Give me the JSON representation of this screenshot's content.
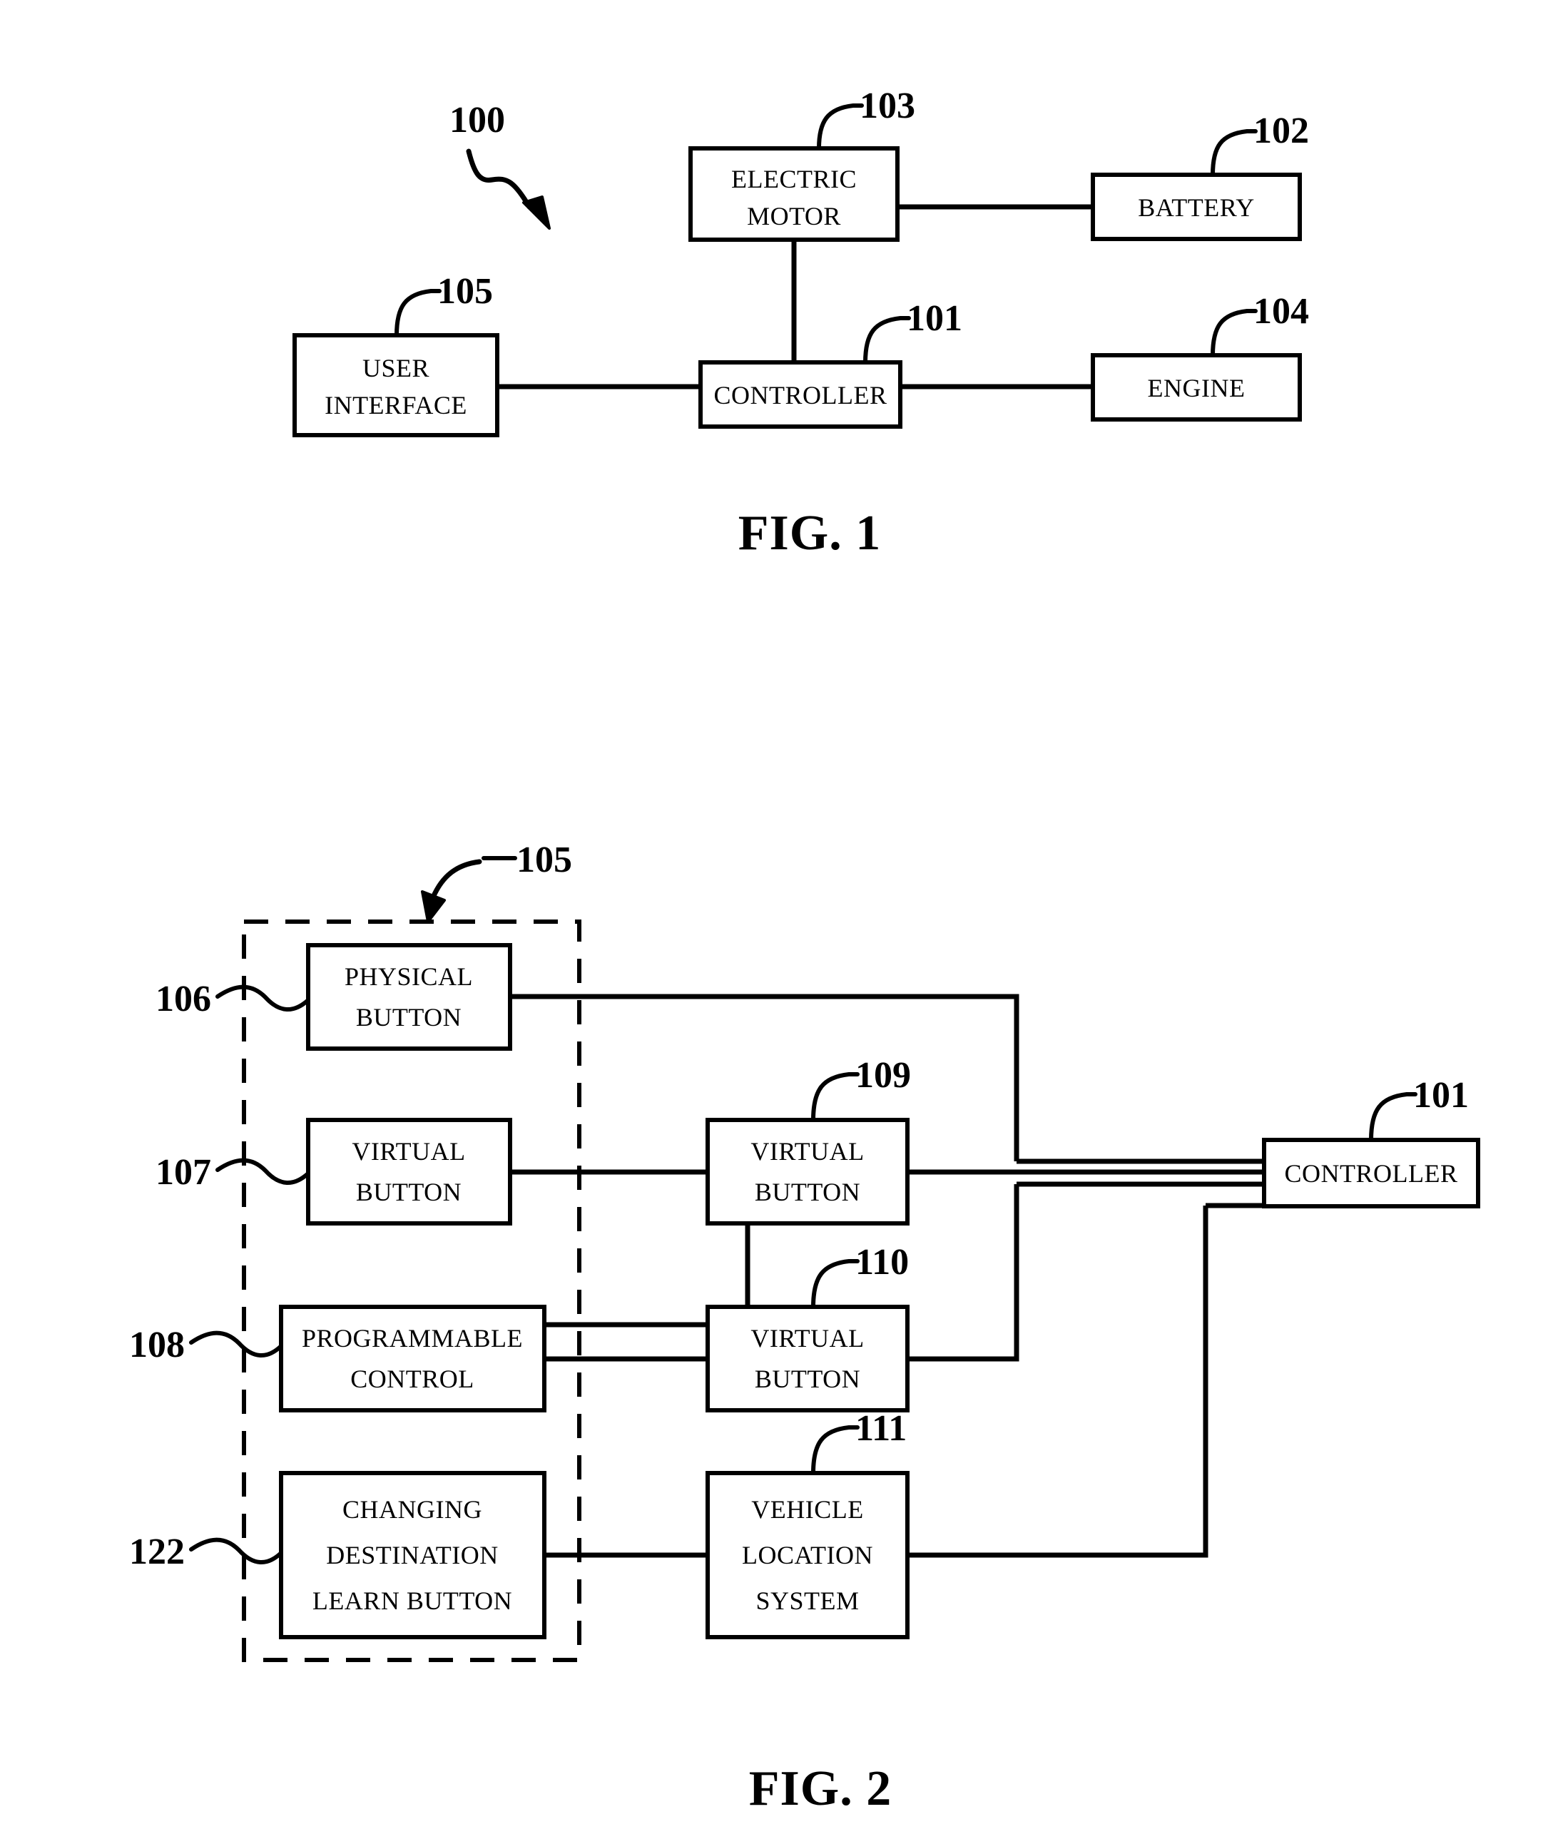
{
  "document": {
    "type": "patent-drawing-sheet",
    "figures": [
      {
        "id": "fig1",
        "caption": "FIG. 1",
        "system_reference": "100",
        "blocks": [
          {
            "ref": "103",
            "label_line1": "ELECTRIC",
            "label_line2": "MOTOR"
          },
          {
            "ref": "102",
            "label_line1": "BATTERY",
            "label_line2": ""
          },
          {
            "ref": "105",
            "label_line1": "USER",
            "label_line2": "INTERFACE"
          },
          {
            "ref": "101",
            "label_line1": "CONTROLLER",
            "label_line2": ""
          },
          {
            "ref": "104",
            "label_line1": "ENGINE",
            "label_line2": ""
          }
        ],
        "connections": [
          {
            "from": "103",
            "to": "102"
          },
          {
            "from": "103",
            "to": "101"
          },
          {
            "from": "105",
            "to": "101"
          },
          {
            "from": "101",
            "to": "104"
          }
        ]
      },
      {
        "id": "fig2",
        "caption": "FIG. 2",
        "enclosure_reference": "105",
        "blocks": [
          {
            "ref": "106",
            "label_line1": "PHYSICAL",
            "label_line2": "BUTTON",
            "label_line3": ""
          },
          {
            "ref": "107",
            "label_line1": "VIRTUAL",
            "label_line2": "BUTTON",
            "label_line3": ""
          },
          {
            "ref": "108",
            "label_line1": "PROGRAMMABLE",
            "label_line2": "CONTROL",
            "label_line3": ""
          },
          {
            "ref": "122",
            "label_line1": "CHANGING",
            "label_line2": "DESTINATION",
            "label_line3": "LEARN BUTTON"
          },
          {
            "ref": "109",
            "label_line1": "VIRTUAL",
            "label_line2": "BUTTON",
            "label_line3": ""
          },
          {
            "ref": "110",
            "label_line1": "VIRTUAL",
            "label_line2": "BUTTON",
            "label_line3": ""
          },
          {
            "ref": "111",
            "label_line1": "VEHICLE",
            "label_line2": "LOCATION",
            "label_line3": "SYSTEM"
          },
          {
            "ref": "101",
            "label_line1": "CONTROLLER",
            "label_line2": "",
            "label_line3": ""
          }
        ],
        "connections": [
          {
            "from": "106",
            "to": "101"
          },
          {
            "from": "107",
            "to": "109"
          },
          {
            "from": "108",
            "to": "109"
          },
          {
            "from": "108",
            "to": "110"
          },
          {
            "from": "109",
            "to": "101"
          },
          {
            "from": "110",
            "to": "101"
          },
          {
            "from": "122",
            "to": "111"
          },
          {
            "from": "111",
            "to": "101"
          }
        ]
      }
    ]
  },
  "fig1": {
    "caption": "FIG. 1",
    "ref_system": "100",
    "electric_motor": {
      "line1": "ELECTRIC",
      "line2": "MOTOR",
      "ref": "103"
    },
    "battery": {
      "line1": "BATTERY",
      "ref": "102"
    },
    "user_interface": {
      "line1": "USER",
      "line2": "INTERFACE",
      "ref": "105"
    },
    "controller": {
      "line1": "CONTROLLER",
      "ref": "101"
    },
    "engine": {
      "line1": "ENGINE",
      "ref": "104"
    }
  },
  "fig2": {
    "caption": "FIG. 2",
    "ref_enclosure": "105",
    "physical_button": {
      "line1": "PHYSICAL",
      "line2": "BUTTON",
      "ref": "106"
    },
    "virtual_button_left": {
      "line1": "VIRTUAL",
      "line2": "BUTTON",
      "ref": "107"
    },
    "programmable_control": {
      "line1": "PROGRAMMABLE",
      "line2": "CONTROL",
      "ref": "108"
    },
    "changing_destination": {
      "line1": "CHANGING",
      "line2": "DESTINATION",
      "line3": "LEARN BUTTON",
      "ref": "122"
    },
    "virtual_button_109": {
      "line1": "VIRTUAL",
      "line2": "BUTTON",
      "ref": "109"
    },
    "virtual_button_110": {
      "line1": "VIRTUAL",
      "line2": "BUTTON",
      "ref": "110"
    },
    "vehicle_location_system": {
      "line1": "VEHICLE",
      "line2": "LOCATION",
      "line3": "SYSTEM",
      "ref": "111"
    },
    "controller": {
      "line1": "CONTROLLER",
      "ref": "101"
    }
  },
  "colors": {
    "ink": "#000000",
    "paper": "#ffffff"
  }
}
